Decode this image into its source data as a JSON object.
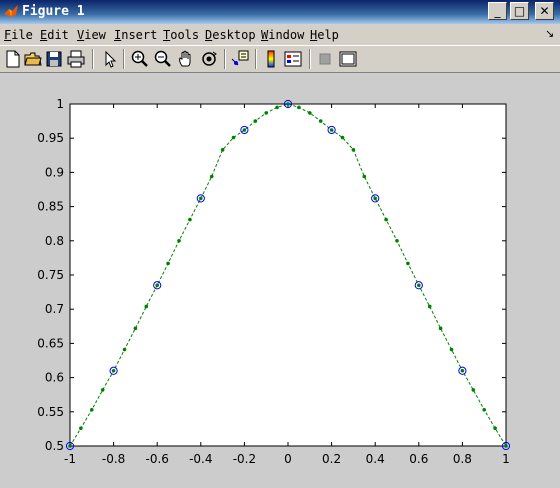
{
  "window": {
    "title": "Figure 1"
  },
  "title_buttons": {
    "minimize": "_",
    "maximize": "□",
    "close": "✕"
  },
  "menu": [
    {
      "label": "File",
      "key": "F"
    },
    {
      "label": "Edit",
      "key": "E"
    },
    {
      "label": "View",
      "key": "V"
    },
    {
      "label": "Insert",
      "key": "I"
    },
    {
      "label": "Tools",
      "key": "T"
    },
    {
      "label": "Desktop",
      "key": "D"
    },
    {
      "label": "Window",
      "key": "W"
    },
    {
      "label": "Help",
      "key": "H"
    }
  ],
  "toolbar_icons": [
    "new-file-icon",
    "open-folder-icon",
    "save-icon",
    "print-icon",
    "pointer-icon",
    "zoom-in-icon",
    "zoom-out-icon",
    "pan-hand-icon",
    "rotate-3d-icon",
    "data-cursor-icon",
    "colorbar-icon",
    "legend-icon",
    "hide-plot-tools-icon",
    "show-plot-tools-icon"
  ],
  "chart_data": {
    "type": "line",
    "xlim": [
      -1,
      1
    ],
    "ylim": [
      0.5,
      1
    ],
    "xticks": [
      "-1",
      "-0.8",
      "-0.6",
      "-0.4",
      "-0.2",
      "0",
      "0.2",
      "0.4",
      "0.6",
      "0.8",
      "1"
    ],
    "yticks": [
      "0.5",
      "0.55",
      "0.6",
      "0.65",
      "0.7",
      "0.75",
      "0.8",
      "0.85",
      "0.9",
      "0.95",
      "1"
    ],
    "grid": false,
    "series": [
      {
        "style": "circle-markers",
        "color": "#0000ff",
        "x": [
          -1,
          -0.8,
          -0.6,
          -0.4,
          -0.2,
          0,
          0.2,
          0.4,
          0.6,
          0.8,
          1
        ],
        "y": [
          0.5,
          0.61,
          0.735,
          0.862,
          0.962,
          1,
          0.962,
          0.862,
          0.735,
          0.61,
          0.5
        ]
      },
      {
        "style": "dashed-line-dots",
        "color": "#008000",
        "x": [
          -1,
          -0.95,
          -0.9,
          -0.85,
          -0.8,
          -0.75,
          -0.7,
          -0.65,
          -0.6,
          -0.55,
          -0.5,
          -0.45,
          -0.4,
          -0.35,
          -0.3,
          -0.25,
          -0.2,
          -0.15,
          -0.1,
          -0.05,
          0,
          0.05,
          0.1,
          0.15,
          0.2,
          0.25,
          0.3,
          0.35,
          0.4,
          0.45,
          0.5,
          0.55,
          0.6,
          0.65,
          0.7,
          0.75,
          0.8,
          0.85,
          0.9,
          0.95,
          1
        ],
        "y": [
          0.5,
          0.526,
          0.553,
          0.582,
          0.61,
          0.641,
          0.672,
          0.704,
          0.735,
          0.767,
          0.8,
          0.831,
          0.862,
          0.894,
          0.933,
          0.951,
          0.962,
          0.975,
          0.987,
          0.995,
          1,
          0.995,
          0.987,
          0.975,
          0.962,
          0.951,
          0.933,
          0.894,
          0.862,
          0.831,
          0.8,
          0.767,
          0.735,
          0.704,
          0.672,
          0.641,
          0.61,
          0.582,
          0.553,
          0.526,
          0.5
        ]
      }
    ]
  }
}
